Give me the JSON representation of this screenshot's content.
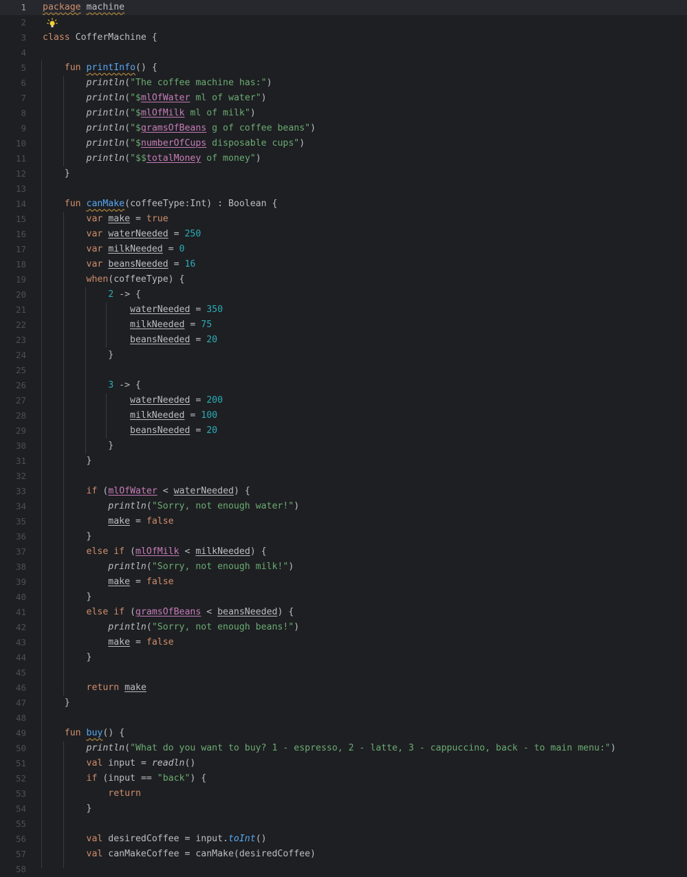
{
  "editor": {
    "current_line": 1,
    "language": "Kotlin"
  },
  "icons": {
    "bulb": "lightbulb-intention-icon"
  },
  "colors": {
    "background": "#1e1f22",
    "keyword": "#cf8e6d",
    "function": "#56a8f5",
    "string": "#6aab73",
    "number": "#2aacb8",
    "field": "#c77dbb"
  },
  "lines": [
    {
      "n": "1",
      "tokens": [
        {
          "t": "package",
          "c": "kw squig"
        },
        {
          "t": " ",
          "c": ""
        },
        {
          "t": "machine",
          "c": "squig"
        }
      ]
    },
    {
      "n": "2",
      "tokens": []
    },
    {
      "n": "3",
      "tokens": [
        {
          "t": "class",
          "c": "kw"
        },
        {
          "t": " CofferMachine {",
          "c": ""
        }
      ]
    },
    {
      "n": "4",
      "tokens": []
    },
    {
      "n": "5",
      "tokens": [
        {
          "t": "    ",
          "c": ""
        },
        {
          "t": "fun",
          "c": "kw"
        },
        {
          "t": " ",
          "c": ""
        },
        {
          "t": "printInfo",
          "c": "fn squig"
        },
        {
          "t": "() {",
          "c": ""
        }
      ]
    },
    {
      "n": "6",
      "tokens": [
        {
          "t": "        ",
          "c": ""
        },
        {
          "t": "println",
          "c": "it"
        },
        {
          "t": "(",
          "c": ""
        },
        {
          "t": "\"The coffee machine has:\"",
          "c": "str"
        },
        {
          "t": ")",
          "c": ""
        }
      ]
    },
    {
      "n": "7",
      "tokens": [
        {
          "t": "        ",
          "c": ""
        },
        {
          "t": "println",
          "c": "it"
        },
        {
          "t": "(",
          "c": ""
        },
        {
          "t": "\"$",
          "c": "str"
        },
        {
          "t": "mlOfWater",
          "c": "fld"
        },
        {
          "t": " ml of water\"",
          "c": "str"
        },
        {
          "t": ")",
          "c": ""
        }
      ]
    },
    {
      "n": "8",
      "tokens": [
        {
          "t": "        ",
          "c": ""
        },
        {
          "t": "println",
          "c": "it"
        },
        {
          "t": "(",
          "c": ""
        },
        {
          "t": "\"$",
          "c": "str"
        },
        {
          "t": "mlOfMilk",
          "c": "fld"
        },
        {
          "t": " ml of milk\"",
          "c": "str"
        },
        {
          "t": ")",
          "c": ""
        }
      ]
    },
    {
      "n": "9",
      "tokens": [
        {
          "t": "        ",
          "c": ""
        },
        {
          "t": "println",
          "c": "it"
        },
        {
          "t": "(",
          "c": ""
        },
        {
          "t": "\"$",
          "c": "str"
        },
        {
          "t": "gramsOfBeans",
          "c": "fld"
        },
        {
          "t": " g of coffee beans\"",
          "c": "str"
        },
        {
          "t": ")",
          "c": ""
        }
      ]
    },
    {
      "n": "10",
      "tokens": [
        {
          "t": "        ",
          "c": ""
        },
        {
          "t": "println",
          "c": "it"
        },
        {
          "t": "(",
          "c": ""
        },
        {
          "t": "\"$",
          "c": "str"
        },
        {
          "t": "numberOfCups",
          "c": "fld"
        },
        {
          "t": " disposable cups\"",
          "c": "str"
        },
        {
          "t": ")",
          "c": ""
        }
      ]
    },
    {
      "n": "11",
      "tokens": [
        {
          "t": "        ",
          "c": ""
        },
        {
          "t": "println",
          "c": "it"
        },
        {
          "t": "(",
          "c": ""
        },
        {
          "t": "\"$$",
          "c": "str"
        },
        {
          "t": "totalMoney",
          "c": "fld"
        },
        {
          "t": " of money\"",
          "c": "str"
        },
        {
          "t": ")",
          "c": ""
        }
      ]
    },
    {
      "n": "12",
      "tokens": [
        {
          "t": "    }",
          "c": ""
        }
      ]
    },
    {
      "n": "13",
      "tokens": []
    },
    {
      "n": "14",
      "tokens": [
        {
          "t": "    ",
          "c": ""
        },
        {
          "t": "fun",
          "c": "kw"
        },
        {
          "t": " ",
          "c": ""
        },
        {
          "t": "canMake",
          "c": "fn squig"
        },
        {
          "t": "(coffeeType:Int) : Boolean {",
          "c": ""
        }
      ]
    },
    {
      "n": "15",
      "tokens": [
        {
          "t": "        ",
          "c": ""
        },
        {
          "t": "var",
          "c": "kw"
        },
        {
          "t": " ",
          "c": ""
        },
        {
          "t": "make",
          "c": "var"
        },
        {
          "t": " = ",
          "c": ""
        },
        {
          "t": "true",
          "c": "kw"
        }
      ]
    },
    {
      "n": "16",
      "tokens": [
        {
          "t": "        ",
          "c": ""
        },
        {
          "t": "var",
          "c": "kw"
        },
        {
          "t": " ",
          "c": ""
        },
        {
          "t": "waterNeeded",
          "c": "var"
        },
        {
          "t": " = ",
          "c": ""
        },
        {
          "t": "250",
          "c": "num"
        }
      ]
    },
    {
      "n": "17",
      "tokens": [
        {
          "t": "        ",
          "c": ""
        },
        {
          "t": "var",
          "c": "kw"
        },
        {
          "t": " ",
          "c": ""
        },
        {
          "t": "milkNeeded",
          "c": "var"
        },
        {
          "t": " = ",
          "c": ""
        },
        {
          "t": "0",
          "c": "num"
        }
      ]
    },
    {
      "n": "18",
      "tokens": [
        {
          "t": "        ",
          "c": ""
        },
        {
          "t": "var",
          "c": "kw"
        },
        {
          "t": " ",
          "c": ""
        },
        {
          "t": "beansNeeded",
          "c": "var"
        },
        {
          "t": " = ",
          "c": ""
        },
        {
          "t": "16",
          "c": "num"
        }
      ]
    },
    {
      "n": "19",
      "tokens": [
        {
          "t": "        ",
          "c": ""
        },
        {
          "t": "when",
          "c": "kw"
        },
        {
          "t": "(coffeeType) {",
          "c": ""
        }
      ]
    },
    {
      "n": "20",
      "tokens": [
        {
          "t": "            ",
          "c": ""
        },
        {
          "t": "2",
          "c": "num"
        },
        {
          "t": " -> {",
          "c": ""
        }
      ]
    },
    {
      "n": "21",
      "tokens": [
        {
          "t": "                ",
          "c": ""
        },
        {
          "t": "waterNeeded",
          "c": "var"
        },
        {
          "t": " = ",
          "c": ""
        },
        {
          "t": "350",
          "c": "num"
        }
      ]
    },
    {
      "n": "22",
      "tokens": [
        {
          "t": "                ",
          "c": ""
        },
        {
          "t": "milkNeeded",
          "c": "var"
        },
        {
          "t": " = ",
          "c": ""
        },
        {
          "t": "75",
          "c": "num"
        }
      ]
    },
    {
      "n": "23",
      "tokens": [
        {
          "t": "                ",
          "c": ""
        },
        {
          "t": "beansNeeded",
          "c": "var"
        },
        {
          "t": " = ",
          "c": ""
        },
        {
          "t": "20",
          "c": "num"
        }
      ]
    },
    {
      "n": "24",
      "tokens": [
        {
          "t": "            }",
          "c": ""
        }
      ]
    },
    {
      "n": "25",
      "tokens": []
    },
    {
      "n": "26",
      "tokens": [
        {
          "t": "            ",
          "c": ""
        },
        {
          "t": "3",
          "c": "num"
        },
        {
          "t": " -> {",
          "c": ""
        }
      ]
    },
    {
      "n": "27",
      "tokens": [
        {
          "t": "                ",
          "c": ""
        },
        {
          "t": "waterNeeded",
          "c": "var"
        },
        {
          "t": " = ",
          "c": ""
        },
        {
          "t": "200",
          "c": "num"
        }
      ]
    },
    {
      "n": "28",
      "tokens": [
        {
          "t": "                ",
          "c": ""
        },
        {
          "t": "milkNeeded",
          "c": "var"
        },
        {
          "t": " = ",
          "c": ""
        },
        {
          "t": "100",
          "c": "num"
        }
      ]
    },
    {
      "n": "29",
      "tokens": [
        {
          "t": "                ",
          "c": ""
        },
        {
          "t": "beansNeeded",
          "c": "var"
        },
        {
          "t": " = ",
          "c": ""
        },
        {
          "t": "20",
          "c": "num"
        }
      ]
    },
    {
      "n": "30",
      "tokens": [
        {
          "t": "            }",
          "c": ""
        }
      ]
    },
    {
      "n": "31",
      "tokens": [
        {
          "t": "        }",
          "c": ""
        }
      ]
    },
    {
      "n": "32",
      "tokens": []
    },
    {
      "n": "33",
      "tokens": [
        {
          "t": "        ",
          "c": ""
        },
        {
          "t": "if",
          "c": "kw"
        },
        {
          "t": " (",
          "c": ""
        },
        {
          "t": "mlOfWater",
          "c": "fld"
        },
        {
          "t": " < ",
          "c": ""
        },
        {
          "t": "waterNeeded",
          "c": "var"
        },
        {
          "t": ") {",
          "c": ""
        }
      ]
    },
    {
      "n": "34",
      "tokens": [
        {
          "t": "            ",
          "c": ""
        },
        {
          "t": "println",
          "c": "it"
        },
        {
          "t": "(",
          "c": ""
        },
        {
          "t": "\"Sorry, not enough water!\"",
          "c": "str"
        },
        {
          "t": ")",
          "c": ""
        }
      ]
    },
    {
      "n": "35",
      "tokens": [
        {
          "t": "            ",
          "c": ""
        },
        {
          "t": "make",
          "c": "var"
        },
        {
          "t": " = ",
          "c": ""
        },
        {
          "t": "false",
          "c": "kw"
        }
      ]
    },
    {
      "n": "36",
      "tokens": [
        {
          "t": "        }",
          "c": ""
        }
      ]
    },
    {
      "n": "37",
      "tokens": [
        {
          "t": "        ",
          "c": ""
        },
        {
          "t": "else if",
          "c": "kw"
        },
        {
          "t": " (",
          "c": ""
        },
        {
          "t": "mlOfMilk",
          "c": "fld"
        },
        {
          "t": " < ",
          "c": ""
        },
        {
          "t": "milkNeeded",
          "c": "var"
        },
        {
          "t": ") {",
          "c": ""
        }
      ]
    },
    {
      "n": "38",
      "tokens": [
        {
          "t": "            ",
          "c": ""
        },
        {
          "t": "println",
          "c": "it"
        },
        {
          "t": "(",
          "c": ""
        },
        {
          "t": "\"Sorry, not enough milk!\"",
          "c": "str"
        },
        {
          "t": ")",
          "c": ""
        }
      ]
    },
    {
      "n": "39",
      "tokens": [
        {
          "t": "            ",
          "c": ""
        },
        {
          "t": "make",
          "c": "var"
        },
        {
          "t": " = ",
          "c": ""
        },
        {
          "t": "false",
          "c": "kw"
        }
      ]
    },
    {
      "n": "40",
      "tokens": [
        {
          "t": "        }",
          "c": ""
        }
      ]
    },
    {
      "n": "41",
      "tokens": [
        {
          "t": "        ",
          "c": ""
        },
        {
          "t": "else if",
          "c": "kw"
        },
        {
          "t": " (",
          "c": ""
        },
        {
          "t": "gramsOfBeans",
          "c": "fld"
        },
        {
          "t": " < ",
          "c": ""
        },
        {
          "t": "beansNeeded",
          "c": "var"
        },
        {
          "t": ") {",
          "c": ""
        }
      ]
    },
    {
      "n": "42",
      "tokens": [
        {
          "t": "            ",
          "c": ""
        },
        {
          "t": "println",
          "c": "it"
        },
        {
          "t": "(",
          "c": ""
        },
        {
          "t": "\"Sorry, not enough beans!\"",
          "c": "str"
        },
        {
          "t": ")",
          "c": ""
        }
      ]
    },
    {
      "n": "43",
      "tokens": [
        {
          "t": "            ",
          "c": ""
        },
        {
          "t": "make",
          "c": "var"
        },
        {
          "t": " = ",
          "c": ""
        },
        {
          "t": "false",
          "c": "kw"
        }
      ]
    },
    {
      "n": "44",
      "tokens": [
        {
          "t": "        }",
          "c": ""
        }
      ]
    },
    {
      "n": "45",
      "tokens": []
    },
    {
      "n": "46",
      "tokens": [
        {
          "t": "        ",
          "c": ""
        },
        {
          "t": "return",
          "c": "kw"
        },
        {
          "t": " ",
          "c": ""
        },
        {
          "t": "make",
          "c": "var"
        }
      ]
    },
    {
      "n": "47",
      "tokens": [
        {
          "t": "    }",
          "c": ""
        }
      ]
    },
    {
      "n": "48",
      "tokens": []
    },
    {
      "n": "49",
      "tokens": [
        {
          "t": "    ",
          "c": ""
        },
        {
          "t": "fun",
          "c": "kw"
        },
        {
          "t": " ",
          "c": ""
        },
        {
          "t": "buy",
          "c": "fn squig"
        },
        {
          "t": "() {",
          "c": ""
        }
      ]
    },
    {
      "n": "50",
      "tokens": [
        {
          "t": "        ",
          "c": ""
        },
        {
          "t": "println",
          "c": "it"
        },
        {
          "t": "(",
          "c": ""
        },
        {
          "t": "\"What do you want to buy? 1 - espresso, 2 - latte, 3 - cappuccino, back - to main menu:\"",
          "c": "str"
        },
        {
          "t": ")",
          "c": ""
        }
      ]
    },
    {
      "n": "51",
      "tokens": [
        {
          "t": "        ",
          "c": ""
        },
        {
          "t": "val",
          "c": "kw"
        },
        {
          "t": " input = ",
          "c": ""
        },
        {
          "t": "readln",
          "c": "it"
        },
        {
          "t": "()",
          "c": ""
        }
      ]
    },
    {
      "n": "52",
      "tokens": [
        {
          "t": "        ",
          "c": ""
        },
        {
          "t": "if",
          "c": "kw"
        },
        {
          "t": " (input == ",
          "c": ""
        },
        {
          "t": "\"back\"",
          "c": "str"
        },
        {
          "t": ") {",
          "c": ""
        }
      ]
    },
    {
      "n": "53",
      "tokens": [
        {
          "t": "            ",
          "c": ""
        },
        {
          "t": "return",
          "c": "kw"
        }
      ]
    },
    {
      "n": "54",
      "tokens": [
        {
          "t": "        }",
          "c": ""
        }
      ]
    },
    {
      "n": "55",
      "tokens": []
    },
    {
      "n": "56",
      "tokens": [
        {
          "t": "        ",
          "c": ""
        },
        {
          "t": "val",
          "c": "kw"
        },
        {
          "t": " desiredCoffee = input.",
          "c": ""
        },
        {
          "t": "toInt",
          "c": "itfn"
        },
        {
          "t": "()",
          "c": ""
        }
      ]
    },
    {
      "n": "57",
      "tokens": [
        {
          "t": "        ",
          "c": ""
        },
        {
          "t": "val",
          "c": "kw"
        },
        {
          "t": " canMakeCoffee = canMake(desiredCoffee)",
          "c": ""
        }
      ]
    },
    {
      "n": "58",
      "tokens": []
    }
  ]
}
